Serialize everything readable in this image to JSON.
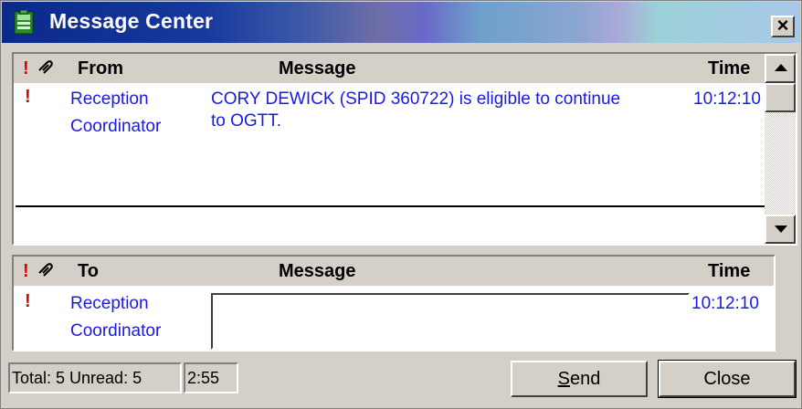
{
  "window": {
    "title": "Message Center",
    "app_icon": "message-center-icon",
    "close_label": "×"
  },
  "inbox": {
    "columns": {
      "importance": "!",
      "attachment": "\u0001",
      "from": "From",
      "message": "Message",
      "time": "Time"
    },
    "rows": [
      {
        "importance": "!",
        "from_line1": "Reception",
        "from_line2": "Coordinator",
        "message_line1": "CORY DEWICK (SPID 360722) is eligible to continue",
        "message_line2": "to OGTT.",
        "time": "10:12:10"
      }
    ]
  },
  "outbox": {
    "columns": {
      "importance": "!",
      "to": "To",
      "message": "Message",
      "time": "Time"
    },
    "row": {
      "importance": "!",
      "to_line1": "Reception",
      "to_line2": "Coordinator",
      "message_value": "",
      "time": "10:12:10"
    }
  },
  "status": {
    "counts": "Total: 5 Unread: 5",
    "timer": "2:55"
  },
  "buttons": {
    "send_prefix": "S",
    "send_rest": "end",
    "close": "Close"
  },
  "colors": {
    "link_text": "#1a1ae6",
    "importance": "#e00000",
    "title_bar_start": "#0b2a8a"
  }
}
